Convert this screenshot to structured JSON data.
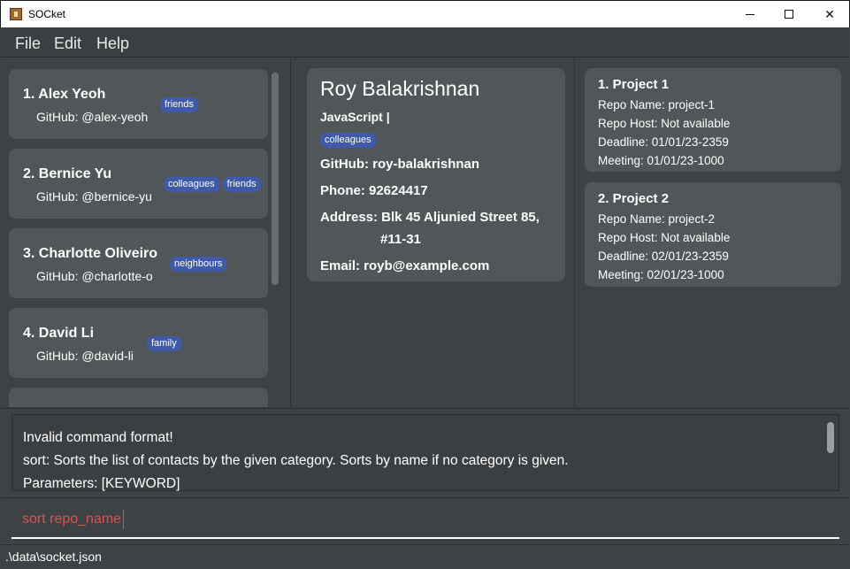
{
  "window": {
    "title": "SOCket",
    "icon": "app-icon",
    "min_glyph": "",
    "max_glyph": "",
    "close_glyph": "✕"
  },
  "menu": {
    "file": "File",
    "edit": "Edit",
    "help": "Help"
  },
  "persons": [
    {
      "name": "1.  Alex Yeoh",
      "github": "GitHub: @alex-yeoh",
      "tags": [
        "friends"
      ]
    },
    {
      "name": "2.  Bernice Yu",
      "github": "GitHub: @bernice-yu",
      "tags": [
        "colleagues",
        "friends"
      ]
    },
    {
      "name": "3.  Charlotte Oliveiro",
      "github": "GitHub: @charlotte-o",
      "tags": [
        "neighbours"
      ]
    },
    {
      "name": "4.  David Li",
      "github": "GitHub: @david-li",
      "tags": [
        "family"
      ]
    }
  ],
  "detail": {
    "name": "Roy Balakrishnan",
    "language": "JavaScript |",
    "tag": "colleagues",
    "github": "GitHub:  roy-balakrishnan",
    "phone": "Phone:  92624417",
    "address_line1": "Address:  Blk 45 Aljunied Street 85,",
    "address_line2": "#11-31",
    "email": "Email:  royb@example.com"
  },
  "projects": [
    {
      "title": "1.  Project 1",
      "repo_name": "Repo Name: project-1",
      "repo_host": "Repo Host: Not available",
      "deadline": "Deadline: 01/01/23-2359",
      "meeting": "Meeting: 01/01/23-1000"
    },
    {
      "title": "2.  Project 2",
      "repo_name": "Repo Name: project-2",
      "repo_host": "Repo Host: Not available",
      "deadline": "Deadline: 02/01/23-2359",
      "meeting": "Meeting: 02/01/23-1000"
    }
  ],
  "result": {
    "line1": "Invalid command format!",
    "line2": "sort: Sorts the list of contacts by the given category. Sorts by name if no category is given.",
    "line3": "Parameters: [KEYWORD]"
  },
  "command": {
    "value": "sort repo_name"
  },
  "status": {
    "path": ".\\data\\socket.json"
  },
  "colors": {
    "background": "#3f4244",
    "card": "#515658",
    "tag": "#3e5aa8",
    "command_text": "#d6554a"
  }
}
